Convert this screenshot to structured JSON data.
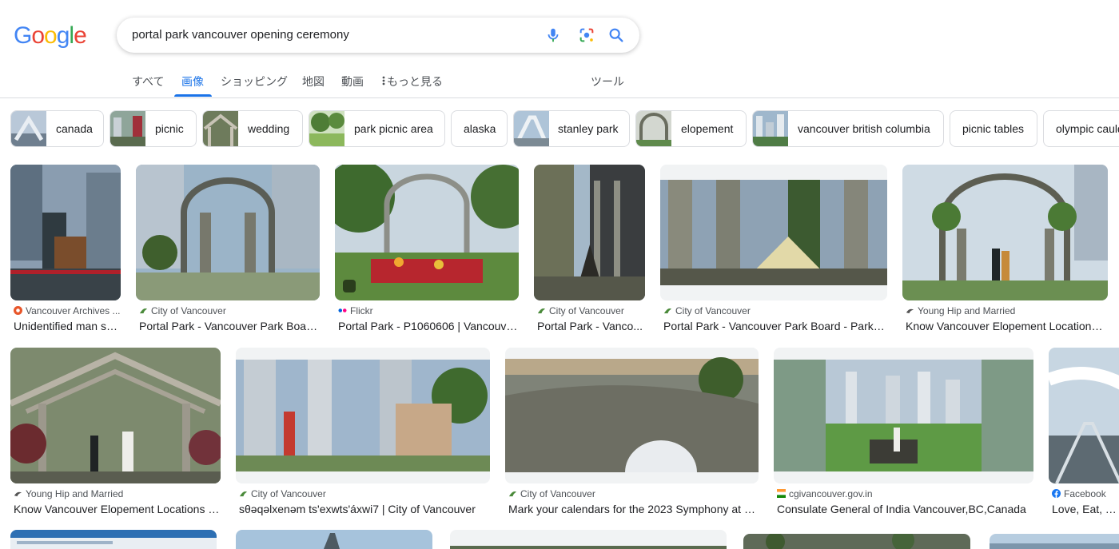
{
  "search": {
    "query": "portal park vancouver opening ceremony"
  },
  "tabs": [
    {
      "label": "すべて"
    },
    {
      "label": "画像"
    },
    {
      "label": "ショッピング"
    },
    {
      "label": "地図"
    },
    {
      "label": "動画"
    },
    {
      "label": "もっと見る"
    }
  ],
  "tools_label": "ツール",
  "chips": [
    {
      "label": "canada"
    },
    {
      "label": "picnic"
    },
    {
      "label": "wedding"
    },
    {
      "label": "park picnic area"
    },
    {
      "label": "alaska"
    },
    {
      "label": "stanley park"
    },
    {
      "label": "elopement"
    },
    {
      "label": "vancouver british columbia"
    },
    {
      "label": "picnic tables"
    },
    {
      "label": "olympic cauldron"
    }
  ],
  "results": [
    {
      "source": "Vancouver Archives ...",
      "title": "Unidentified man sp..."
    },
    {
      "source": "City of Vancouver",
      "title": "Portal Park - Vancouver Park Board..."
    },
    {
      "source": "Flickr",
      "title": "Portal Park - P1060606 | Vancouve..."
    },
    {
      "source": "City of Vancouver",
      "title": "Portal Park - Vanco..."
    },
    {
      "source": "City of Vancouver",
      "title": "Portal Park - Vancouver Park Board - Park Fi..."
    },
    {
      "source": "Young Hip and Married",
      "title": "Know Vancouver Elopement Locations |..."
    },
    {
      "source": "Young Hip and Married",
      "title": "Know Vancouver Elopement Locations | ..."
    },
    {
      "source": "City of Vancouver",
      "title": "sθəqəlxenəm ts'exwts'áxwi7 | City of Vancouver"
    },
    {
      "source": "City of Vancouver",
      "title": "Mark your calendars for the 2023 Symphony at S..."
    },
    {
      "source": "cgivancouver.gov.in",
      "title": "Consulate General of India Vancouver,BC,Canada"
    },
    {
      "source": "Facebook",
      "title": "Love, Eat, Travel"
    }
  ],
  "colors": {
    "google_blue": "#4285f4",
    "google_red": "#ea4335",
    "google_yellow": "#fbbc05",
    "google_green": "#34a853",
    "active_tab": "#1a73e8"
  }
}
